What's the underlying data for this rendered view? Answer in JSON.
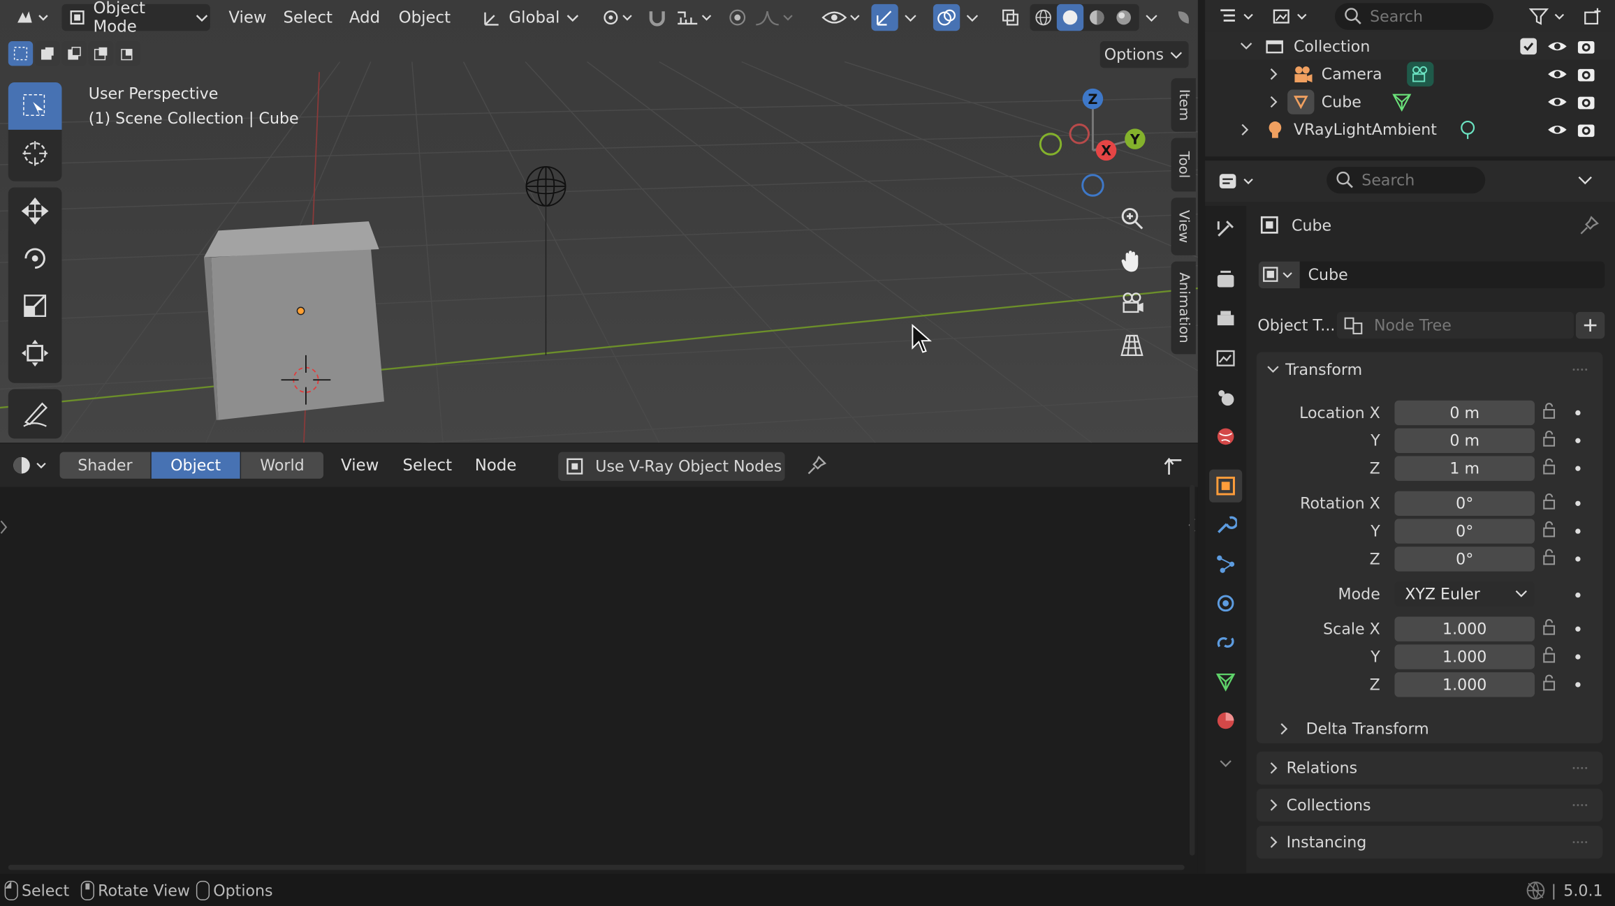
{
  "viewport": {
    "mode_label": "Object Mode",
    "menu": [
      "View",
      "Select",
      "Add",
      "Object"
    ],
    "transform_orientation": "Global",
    "options_label": "Options",
    "overlay_title": "User Perspective",
    "overlay_subtitle": "(1) Scene Collection | Cube",
    "side_tabs": [
      "Item",
      "Tool",
      "View",
      "Animation"
    ],
    "gizmo": {
      "x": "X",
      "y": "Y",
      "z": "Z"
    }
  },
  "node_editor": {
    "tabs": [
      "Shader",
      "Object",
      "World"
    ],
    "active_tab": "Object",
    "menu": [
      "View",
      "Select",
      "Node"
    ],
    "vray_label": "Use V-Ray Object Nodes"
  },
  "outliner": {
    "search_placeholder": "Search",
    "rows": [
      {
        "label": "Collection",
        "icon": "collection-icon"
      },
      {
        "label": "Camera",
        "icon": "camera-icon"
      },
      {
        "label": "Cube",
        "icon": "mesh-icon"
      },
      {
        "label": "VRayLightAmbient",
        "icon": "light-icon"
      }
    ]
  },
  "properties": {
    "search_placeholder": "Search",
    "object_name": "Cube",
    "data_name": "Cube",
    "object_tree_label": "Object T...",
    "node_tree_placeholder": "Node Tree",
    "transform": {
      "title": "Transform",
      "location_label": "Location X",
      "loc_x": "0 m",
      "loc_y": "0 m",
      "loc_z": "1 m",
      "rotation_label": "Rotation X",
      "rot_x": "0°",
      "rot_y": "0°",
      "rot_z": "0°",
      "mode_label": "Mode",
      "mode_value": "XYZ Euler",
      "scale_label": "Scale X",
      "scale_x": "1.000",
      "scale_y": "1.000",
      "scale_z": "1.000",
      "y_label": "Y",
      "z_label": "Z",
      "delta": "Delta Transform"
    },
    "panels": [
      "Relations",
      "Collections",
      "Instancing"
    ]
  },
  "status": {
    "items": [
      "Select",
      "Rotate View",
      "Options"
    ],
    "version": "5.0.1"
  },
  "colors": {
    "accent": "#4772b3",
    "selected_tab": "#4772b3",
    "active_prop_tab": "#ff9d3a"
  }
}
